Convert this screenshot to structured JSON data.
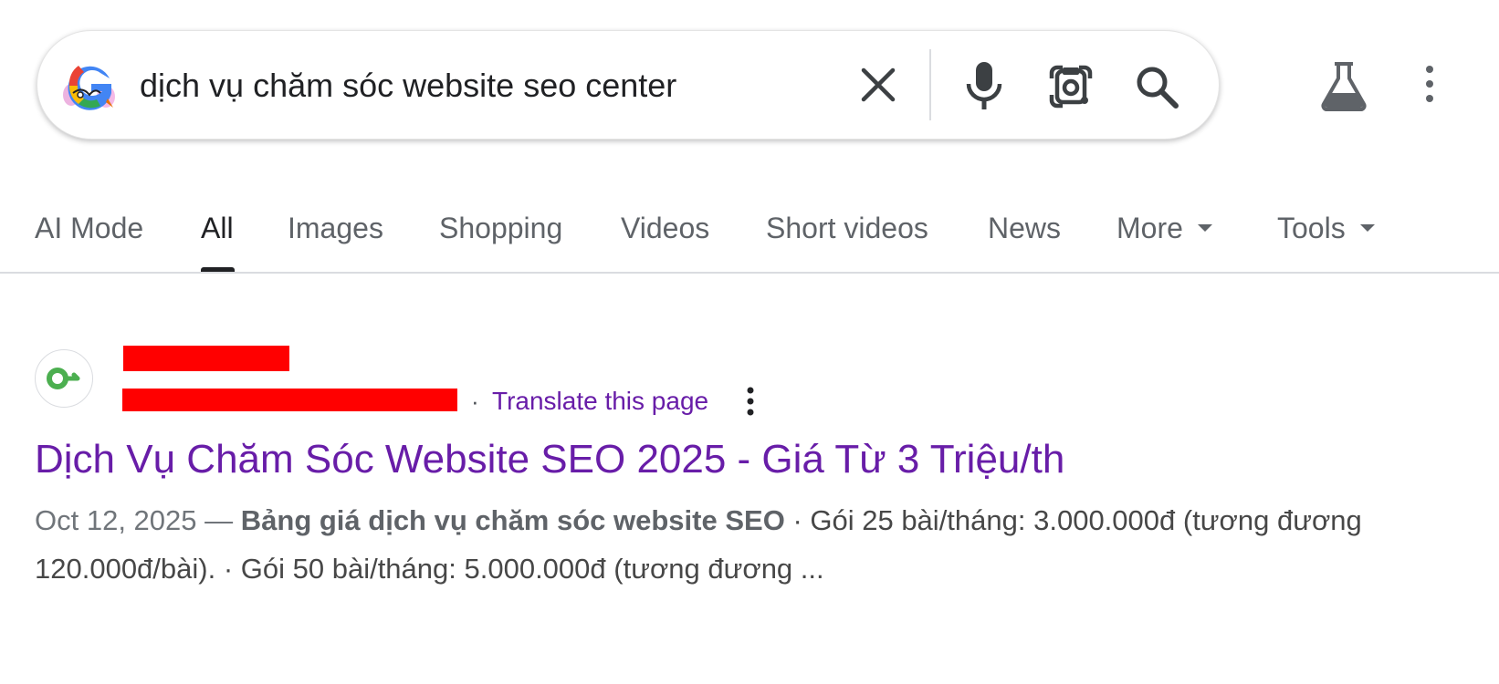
{
  "search": {
    "query": "dịch vụ chăm sóc website seo center"
  },
  "tabs": [
    {
      "label": "AI Mode",
      "active": false
    },
    {
      "label": "All",
      "active": true
    },
    {
      "label": "Images",
      "active": false
    },
    {
      "label": "Shopping",
      "active": false
    },
    {
      "label": "Videos",
      "active": false
    },
    {
      "label": "Short videos",
      "active": false
    },
    {
      "label": "News",
      "active": false
    },
    {
      "label": "More",
      "active": false
    },
    {
      "label": "Tools",
      "active": false
    }
  ],
  "result": {
    "translate_label": "Translate this page",
    "separator": "·",
    "title": "Dịch Vụ Chăm Sóc Website SEO 2025 - Giá Từ 3 Triệu/th",
    "snippet_date": "Oct 12, 2025 —",
    "snippet_bold": "Bảng giá dịch vụ chăm sóc website SEO",
    "snippet_rest": "· Gói 25 bài/tháng: 3.000.000đ (tương đương 120.000đ/bài). · Gói 50 bài/tháng: 5.000.000đ (tương đương ..."
  },
  "colors": {
    "link_visited": "#681da8",
    "redaction": "#ff0000",
    "favicon_green": "#4caf50"
  },
  "icons": [
    "google-g-icon",
    "clear-icon",
    "mic-icon",
    "lens-icon",
    "search-icon",
    "labs-flask-icon",
    "more-vert-icon",
    "site-favicon"
  ]
}
